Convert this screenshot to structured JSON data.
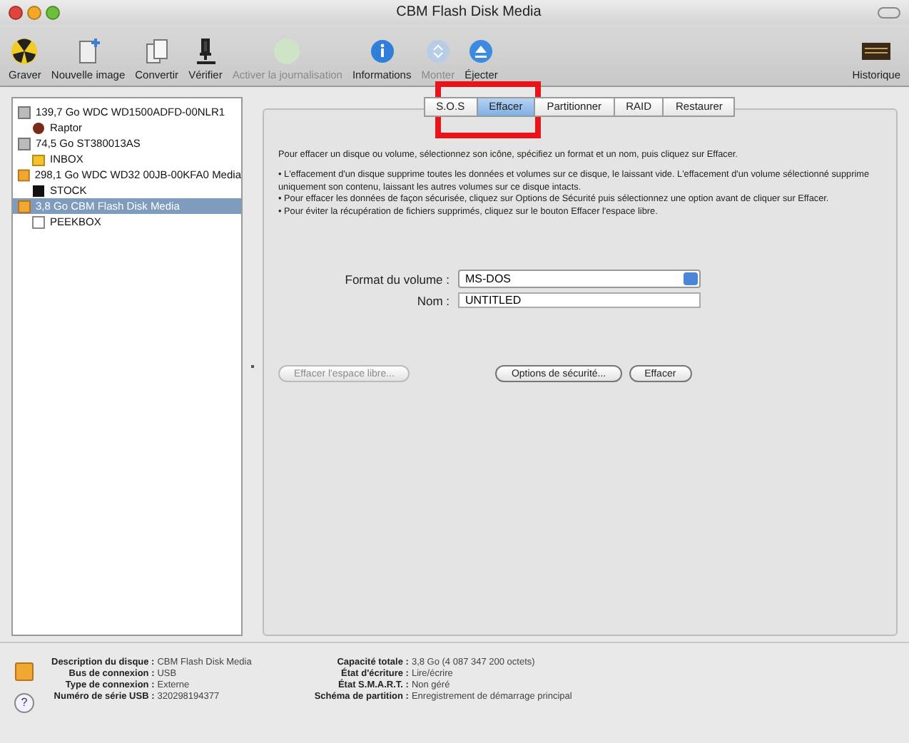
{
  "window": {
    "title": "CBM Flash Disk Media"
  },
  "toolbar": [
    {
      "kind": "burn",
      "label": "Graver",
      "disabled": false
    },
    {
      "kind": "new-image",
      "label": "Nouvelle image",
      "disabled": false
    },
    {
      "kind": "convert",
      "label": "Convertir",
      "disabled": false
    },
    {
      "kind": "verify",
      "label": "Vérifier",
      "disabled": false
    },
    {
      "kind": "journal",
      "label": "Activer la journalisation",
      "disabled": true
    },
    {
      "kind": "info",
      "label": "Informations",
      "disabled": false
    },
    {
      "kind": "mount",
      "label": "Monter",
      "disabled": true
    },
    {
      "kind": "eject",
      "label": "Éjecter",
      "disabled": false
    }
  ],
  "toolbar_right": {
    "kind": "log",
    "label": "Historique"
  },
  "sidebar": {
    "items": [
      {
        "kind": "internal-disk",
        "label": "139,7 Go WDC WD1500ADFD-00NLR1",
        "selected": false,
        "children": [
          {
            "kind": "raptor-volume",
            "label": "Raptor",
            "selected": false
          }
        ]
      },
      {
        "kind": "internal-disk",
        "label": "74,5 Go ST380013AS",
        "selected": false,
        "children": [
          {
            "kind": "folder-volume",
            "label": "INBOX",
            "selected": false
          }
        ]
      },
      {
        "kind": "external-disk",
        "label": "298,1 Go WDC WD32 00JB-00KFA0 Media",
        "selected": false,
        "children": [
          {
            "kind": "dark-volume",
            "label": "STOCK",
            "selected": false
          }
        ]
      },
      {
        "kind": "external-disk",
        "label": "3,8 Go CBM Flash Disk Media",
        "selected": true,
        "children": [
          {
            "kind": "plain-volume",
            "label": "PEEKBOX",
            "selected": false
          }
        ]
      }
    ]
  },
  "tabs": [
    {
      "label": "S.O.S",
      "selected": false
    },
    {
      "label": "Effacer",
      "selected": true
    },
    {
      "label": "Partitionner",
      "selected": false
    },
    {
      "label": "RAID",
      "selected": false
    },
    {
      "label": "Restaurer",
      "selected": false
    }
  ],
  "intro": "Pour effacer un disque ou volume, sélectionnez son icône, spécifiez un format et un nom, puis cliquez sur Effacer.",
  "notes": [
    "• L'effacement d'un disque supprime toutes les données et volumes sur ce disque, le laissant vide. L'effacement d'un volume sélectionné supprime uniquement son contenu, laissant les autres volumes sur ce disque intacts.",
    "• Pour effacer les données de façon sécurisée, cliquez sur Options de Sécurité puis sélectionnez une option avant de cliquer sur Effacer.",
    "• Pour éviter la récupération de fichiers supprimés, cliquez sur le bouton Effacer l'espace libre."
  ],
  "format": {
    "label": "Format du volume :",
    "value": "MS-DOS"
  },
  "name": {
    "label": "Nom :",
    "value": "UNTITLED"
  },
  "buttons": [
    {
      "label": "Effacer l'espace libre...",
      "disabled": true
    },
    {
      "label": "Options de sécurité...",
      "disabled": false
    },
    {
      "label": "Effacer",
      "disabled": false
    }
  ],
  "info": {
    "left": [
      {
        "key": "Description du disque :",
        "value": "CBM Flash Disk Media"
      },
      {
        "key": "Bus de connexion :",
        "value": "USB"
      },
      {
        "key": "Type de connexion :",
        "value": "Externe"
      },
      {
        "key": "Numéro de série USB :",
        "value": "320298194377"
      }
    ],
    "right": [
      {
        "key": "Capacité totale :",
        "value": "3,8 Go (4 087 347 200 octets)"
      },
      {
        "key": "État d'écriture :",
        "value": "Lire/écrire"
      },
      {
        "key": "État S.M.A.R.T. :",
        "value": "Non géré"
      },
      {
        "key": "Schéma de partition :",
        "value": "Enregistrement de démarrage principal"
      }
    ]
  },
  "help": {
    "label": "?"
  }
}
